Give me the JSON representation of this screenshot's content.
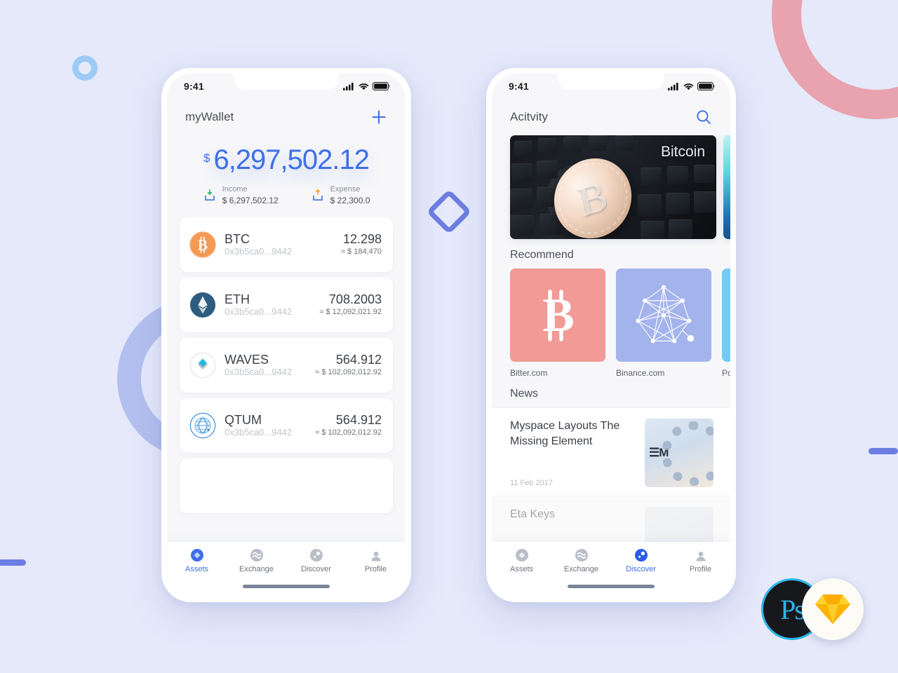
{
  "background": {
    "color": "#e5e9fa",
    "shapes": [
      {
        "name": "ring-pink",
        "color": "#e8a3ae"
      },
      {
        "name": "ring-periwinkle",
        "color": "#b3c0ef"
      },
      {
        "name": "ring-small-blue",
        "color": "#9ecbf5"
      },
      {
        "name": "diamond-outline",
        "color": "#6c7ee1"
      },
      {
        "name": "bar-left",
        "color": "#6c7ee1"
      },
      {
        "name": "bar-right",
        "color": "#6c7ee1"
      }
    ]
  },
  "accent": "#3d6fe8",
  "wallet_screen": {
    "statusbar": {
      "time": "9:41",
      "icons": [
        "signal-icon",
        "wifi-icon",
        "battery-icon"
      ]
    },
    "header": {
      "title": "myWallet",
      "action_icon": "plus-icon"
    },
    "balance": {
      "currency_symbol": "$",
      "amount": "6,297,502.12",
      "income": {
        "icon": "income-arrow-icon",
        "label": "Income",
        "value": "$ 6,297,502.12"
      },
      "expense": {
        "icon": "expense-arrow-icon",
        "label": "Expense",
        "value": "$ 22,300.0"
      }
    },
    "coins": [
      {
        "icon": "btc-coin-icon",
        "symbol": "BTC",
        "address": "0x3b5ca0...9442",
        "amount": "12.298",
        "fiat": "≈ $ 184,470"
      },
      {
        "icon": "eth-coin-icon",
        "symbol": "ETH",
        "address": "0x3b5ca0...9442",
        "amount": "708.2003",
        "fiat": "≈ $ 12,092,021.92"
      },
      {
        "icon": "waves-coin-icon",
        "symbol": "WAVES",
        "address": "0x3b5ca0...9442",
        "amount": "564.912",
        "fiat": "≈ $ 102,092,012.92"
      },
      {
        "icon": "qtum-coin-icon",
        "symbol": "QTUM",
        "address": "0x3b5ca0...9442",
        "amount": "564.912",
        "fiat": "≈ $ 102,092,012.92"
      }
    ],
    "tabs": [
      {
        "icon": "assets-icon",
        "label": "Assets",
        "active": true
      },
      {
        "icon": "exchange-icon",
        "label": "Exchange",
        "active": false
      },
      {
        "icon": "discover-icon",
        "label": "Discover",
        "active": false
      },
      {
        "icon": "profile-icon",
        "label": "Profile",
        "active": false
      }
    ]
  },
  "discover_screen": {
    "statusbar": {
      "time": "9:41",
      "icons": [
        "signal-icon",
        "wifi-icon",
        "battery-icon"
      ]
    },
    "header": {
      "title": "Acitvity",
      "action_icon": "search-icon"
    },
    "banners": [
      {
        "label": "Bitcoin",
        "image": "bitcoin-on-keyboard-photo"
      },
      {
        "label": "",
        "image": "aurora-photo"
      }
    ],
    "recommend": {
      "title": "Recommend",
      "items": [
        {
          "name": "Bitter.com",
          "color": "#f19a96",
          "icon": "bitcoin-glyph-icon"
        },
        {
          "name": "Binance.com",
          "color": "#a3b3ec",
          "icon": "network-graph-icon"
        },
        {
          "name": "Polonl",
          "color": "#72cbf2",
          "icon": "polo-glyph-icon"
        }
      ]
    },
    "news": {
      "title": "News",
      "items": [
        {
          "title": "Myspace Layouts The Missing Element",
          "date": "11 Feb 2017",
          "thumb": "ibm-disc-photo"
        },
        {
          "title": "Eta Keys",
          "date": "",
          "thumb": "person-photo"
        }
      ]
    },
    "tabs": [
      {
        "icon": "assets-icon",
        "label": "Assets",
        "active": false
      },
      {
        "icon": "exchange-icon",
        "label": "Exchange",
        "active": false
      },
      {
        "icon": "discover-icon",
        "label": "Discover",
        "active": true
      },
      {
        "icon": "profile-icon",
        "label": "Profile",
        "active": false
      }
    ]
  },
  "badges": [
    {
      "name": "photoshop-badge",
      "label": "Ps",
      "color": "#2bb5e8"
    },
    {
      "name": "sketch-badge",
      "label": "",
      "color": "#f7a417"
    }
  ]
}
